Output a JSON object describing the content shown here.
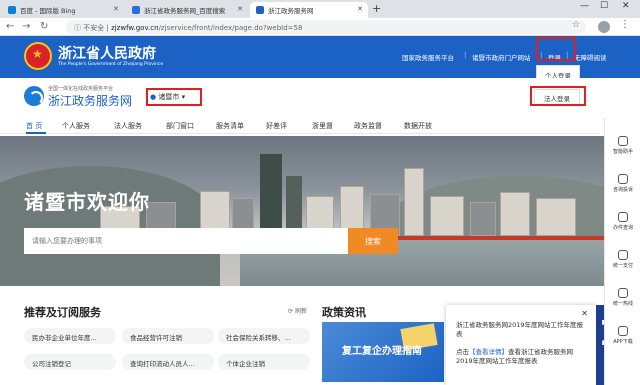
{
  "browser": {
    "tabs": [
      {
        "title": "百度 - 国际版 Bing",
        "active": false
      },
      {
        "title": "浙江省政务服务网_百度搜索",
        "active": false
      },
      {
        "title": "浙江政务服务网",
        "active": true
      }
    ],
    "url_prefix": "不安全",
    "url_domain": "zjzwfw.gov.cn",
    "url_path": "/zjservice/front/index/page.do?webId=58"
  },
  "header": {
    "title": "浙江省人民政府",
    "subtitle": "The People's Government of Zhejiang Province",
    "links": [
      "国家政务服务平台",
      "诸暨市政府门户网站",
      "登录",
      "无障碍阅读"
    ],
    "login_dropdown": "个人登录"
  },
  "subheader": {
    "small_text": "全国一体化在线政务服务平台",
    "title": "浙江政务服务网",
    "city": "诸暨市",
    "corp_login": "法人登录"
  },
  "nav": [
    "首 页",
    "个人服务",
    "法人服务",
    "部门窗口",
    "服务清单",
    "好差评",
    "浙里督",
    "政务监督",
    "数据开放"
  ],
  "hero": {
    "welcome": "诸暨市欢迎你",
    "search_placeholder": "请输入您要办理的事项",
    "search_button": "搜索"
  },
  "recommend": {
    "title": "推荐及订阅服务",
    "refresh": "刷新",
    "chips": [
      "民办非企业单位年度...",
      "食品经营许可注销",
      "社会保险关系转移、...",
      "公司注销登记",
      "查询打印流动人员人...",
      "个体企业注销"
    ]
  },
  "policy": {
    "title": "政策资讯",
    "image_text": "复工复企办理指南"
  },
  "popup": {
    "line1": "浙江省政务服务网2019年度网站工作年度报表",
    "line2_prefix": "点击",
    "line2_link": "【查看详情】",
    "line2_rest": "查看浙江省政务服务网2019年度网站工作年度报表"
  },
  "rail": [
    "智能助手",
    "咨询投诉",
    "办件查询",
    "统一支付",
    "统一热线",
    "APP下载"
  ]
}
